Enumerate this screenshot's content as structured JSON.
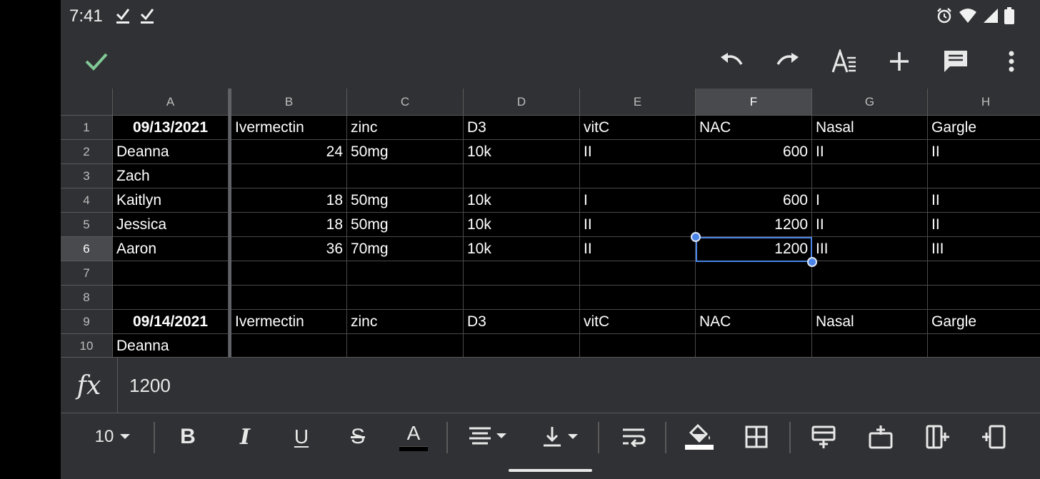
{
  "status_bar": {
    "time": "7:41"
  },
  "toolbar": {
    "confirm": "confirm",
    "undo": "undo",
    "redo": "redo",
    "text_format": "text format",
    "insert": "insert",
    "comment": "comment",
    "more": "more options"
  },
  "columns": [
    "A",
    "B",
    "C",
    "D",
    "E",
    "F",
    "G",
    "H"
  ],
  "rows": [
    "1",
    "2",
    "3",
    "4",
    "5",
    "6",
    "7",
    "8",
    "9",
    "10"
  ],
  "cells": {
    "r1": [
      "09/13/2021",
      "Ivermectin",
      "zinc",
      "D3",
      "vitC",
      "NAC",
      "Nasal",
      "Gargle"
    ],
    "r2": [
      "Deanna",
      "24",
      "50mg",
      "10k",
      "II",
      "600",
      "II",
      "II"
    ],
    "r3": [
      "Zach",
      "",
      "",
      "",
      "",
      "",
      "",
      ""
    ],
    "r4": [
      "Kaitlyn",
      "18",
      "50mg",
      "10k",
      "I",
      "600",
      "I",
      "II"
    ],
    "r5": [
      "Jessica",
      "18",
      "50mg",
      "10k",
      "II",
      "1200",
      "II",
      "II"
    ],
    "r6": [
      "Aaron",
      "36",
      "70mg",
      "10k",
      "II",
      "1200",
      "III",
      "III"
    ],
    "r7": [
      "",
      "",
      "",
      "",
      "",
      "",
      "",
      ""
    ],
    "r8": [
      "",
      "",
      "",
      "",
      "",
      "",
      "",
      ""
    ],
    "r9": [
      "09/14/2021",
      "Ivermectin",
      "zinc",
      "D3",
      "vitC",
      "NAC",
      "Nasal",
      "Gargle"
    ],
    "r10": [
      "Deanna",
      "",
      "",
      "",
      "",
      "",
      "",
      ""
    ]
  },
  "selection": {
    "column": "F",
    "row": "6"
  },
  "formula_bar": {
    "fx_label": "fx",
    "value": "1200"
  },
  "format_toolbar": {
    "font_size": "10",
    "bold": "B",
    "italic": "I",
    "underline": "U",
    "strikethrough": "S",
    "text_color": "A"
  },
  "colors": {
    "background": "#303134",
    "grid": "#000000",
    "selection": "#4a84e6",
    "confirm": "#81c995"
  }
}
